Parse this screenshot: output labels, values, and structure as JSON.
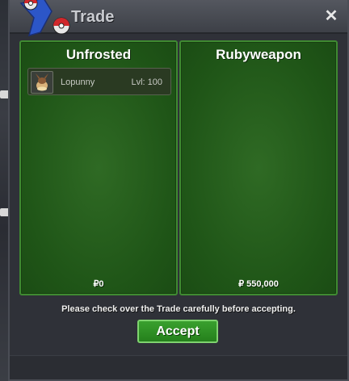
{
  "window": {
    "title": "Trade",
    "close_label": "✕"
  },
  "left_panel": {
    "player": "Unfrosted",
    "items": [
      {
        "name": "Lopunny",
        "level": "Lvl: 100",
        "icon": "lopunny-icon"
      }
    ],
    "money": "₽0"
  },
  "right_panel": {
    "player": "Rubyweapon",
    "items": [],
    "money": "₽ 550,000"
  },
  "notice": "Please check over the Trade carefully before accepting.",
  "accept_label": "Accept",
  "colors": {
    "panel_green": "#1f5517",
    "button_green": "#2f9a24",
    "window_bg": "#2f3138"
  }
}
